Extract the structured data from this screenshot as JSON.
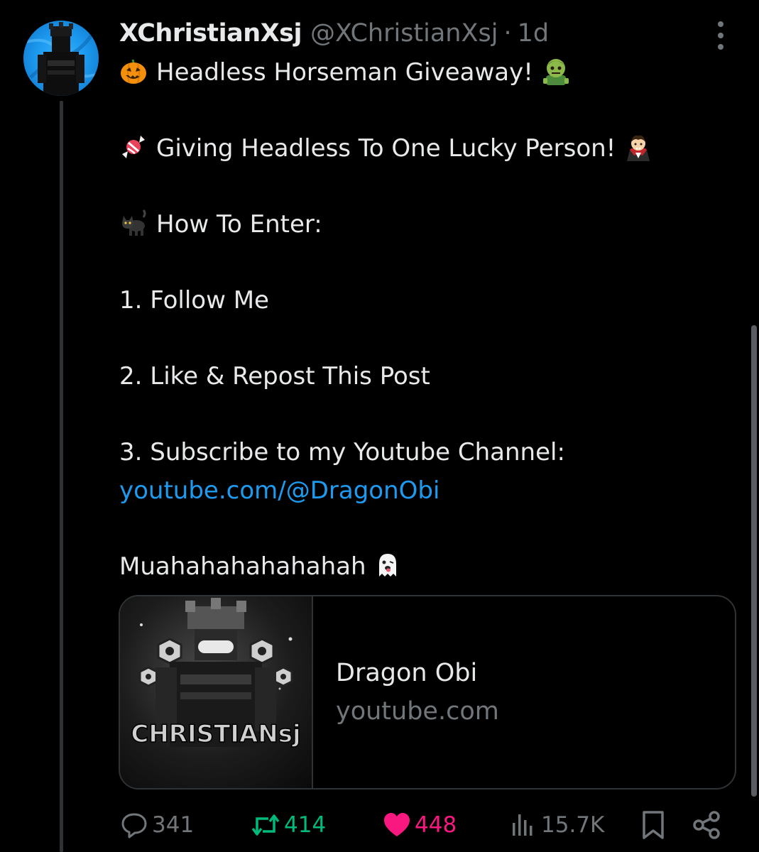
{
  "post": {
    "display_name": "XChristianXsj",
    "handle": "@XChristianXsj",
    "separator": "·",
    "time": "1d",
    "lines": {
      "line1": "Headless Horseman Giveaway!",
      "line2": "Giving Headless To One Lucky Person!",
      "line3": "How To Enter:",
      "step1": "1. Follow Me",
      "step2": "2. Like & Repost This Post",
      "step3": "3. Subscribe to my Youtube Channel:",
      "link": "youtube.com/@DragonObi",
      "outro": "Muahahahahahahah"
    },
    "emojis": {
      "line1_lead": "pumpkin-emoji",
      "line1_trail": "zombie-emoji",
      "line2_lead": "candy-emoji",
      "line2_trail": "vampire-emoji",
      "line3_lead": "black-cat-emoji",
      "outro_trail": "ghost-emoji"
    }
  },
  "card": {
    "title": "Dragon Obi",
    "domain": "youtube.com",
    "thumbnail_text": "CHRISTIANsj"
  },
  "actions": {
    "replies": "341",
    "reposts": "414",
    "likes": "448",
    "views": "15.7K"
  },
  "colors": {
    "background": "#000000",
    "text": "#e7e9ea",
    "muted": "#71767b",
    "link": "#1d9bf0",
    "repost": "#00ba7c",
    "like": "#f91880",
    "border": "#2f3336"
  }
}
